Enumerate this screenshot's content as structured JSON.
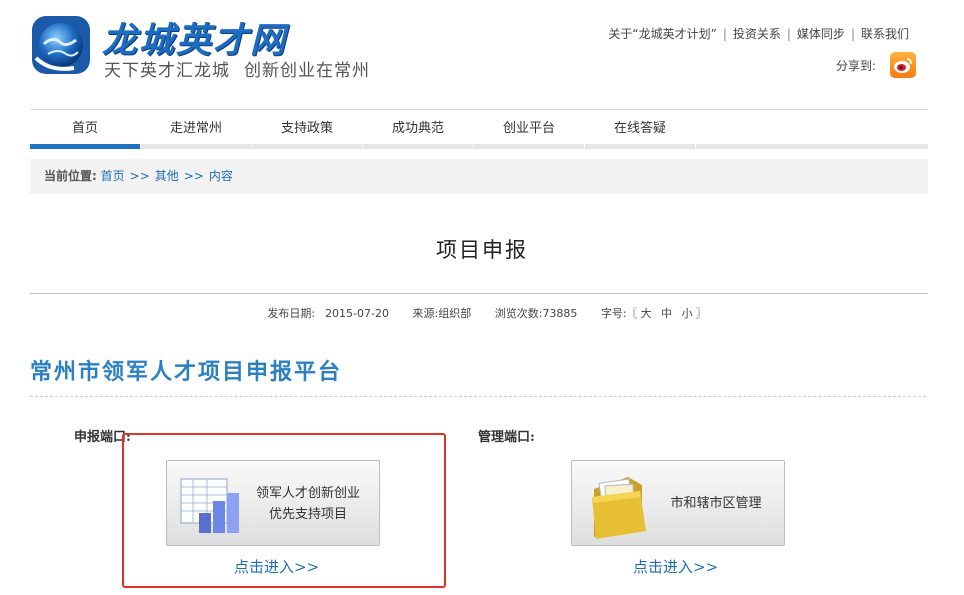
{
  "logo": {
    "title": "龙城英才网",
    "slogan_1": "天下英才汇龙城",
    "slogan_2": "创新创业在常州"
  },
  "top_links": [
    "关于“龙城英才计划”",
    "投资关系",
    "媒体同步",
    "联系我们"
  ],
  "share": {
    "label": "分享到:",
    "icon": "weibo-icon"
  },
  "nav": {
    "items": [
      "首页",
      "走进常州",
      "支持政策",
      "成功典范",
      "创业平台",
      "在线答疑"
    ],
    "active_index": 0,
    "accent": "#1e73be"
  },
  "breadcrumb": {
    "label": "当前位置:",
    "items": [
      "首页",
      "其他",
      "内容"
    ],
    "separator": ">>"
  },
  "article": {
    "title": "项目申报",
    "date_label": "发布日期:",
    "date": "2015-07-20",
    "source_label": "来源:",
    "source": "组织部",
    "views_label": "浏览次数:",
    "views": "73885",
    "font_label": "字号:",
    "font_open": "〖",
    "font_large": "大",
    "font_medium": "中",
    "font_small": "小",
    "font_close": "〗"
  },
  "platform_title": "常州市领军人才项目申报平台",
  "apply_portal": {
    "label": "申报端口:",
    "card_line1": "领军人才创新创业",
    "card_line2": "优先支持项目",
    "enter": "点击进入>>"
  },
  "admin_portal": {
    "label": "管理端口:",
    "card_text": "市和辖市区管理",
    "enter": "点击进入>>"
  },
  "colors": {
    "brand_blue": "#1d6cc2",
    "link_blue": "#1e6db6",
    "highlight_red": "#e0312b"
  }
}
